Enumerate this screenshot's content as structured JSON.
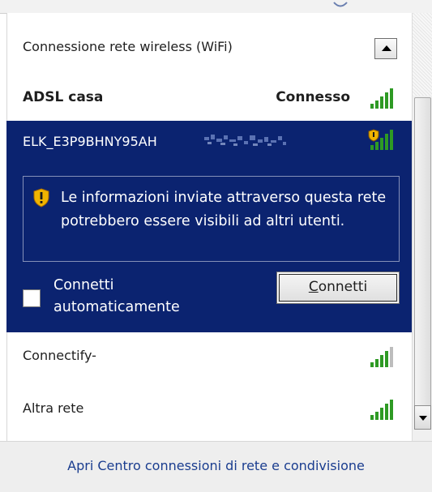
{
  "section": {
    "label": "Connessione rete wireless  (WiFi)",
    "collapse_icon": "triangle-up-icon"
  },
  "networks": [
    {
      "name": "ADSL casa",
      "status": "Connesso",
      "signal_bars": 5,
      "signal_icon": "signal-bars-icon"
    },
    {
      "name": "ELK_E3P9BHNY95AH",
      "status": "",
      "signal_bars": 5,
      "signal_icon": "signal-bars-shield-icon"
    },
    {
      "name": "Connectify-",
      "status": "",
      "signal_bars": 4,
      "signal_icon": "signal-bars-icon"
    },
    {
      "name": "Altra rete",
      "status": "",
      "signal_bars": 5,
      "signal_icon": "signal-bars-icon"
    }
  ],
  "selected": {
    "warning": "Le informazioni inviate attraverso questa rete potrebbero essere visibili ad altri utenti.",
    "auto_connect_label": "Connetti automaticamente",
    "auto_connect_checked": false,
    "connect_button_prefix": "",
    "connect_button_accel": "C",
    "connect_button_rest": "onnetti"
  },
  "footer": {
    "link": "Apri Centro connessioni di rete e condivisione"
  },
  "colors": {
    "selected_bg": "#0b2370",
    "signal_green": "#2e9a24",
    "link": "#1a3d8f",
    "shield": "#f0b400"
  }
}
